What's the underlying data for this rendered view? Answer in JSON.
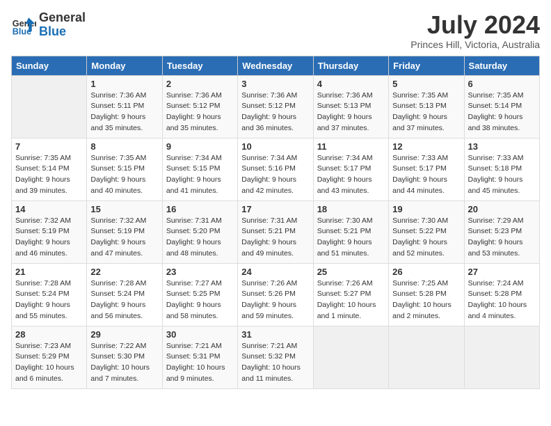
{
  "header": {
    "logo_line1": "General",
    "logo_line2": "Blue",
    "month_title": "July 2024",
    "location": "Princes Hill, Victoria, Australia"
  },
  "days_of_week": [
    "Sunday",
    "Monday",
    "Tuesday",
    "Wednesday",
    "Thursday",
    "Friday",
    "Saturday"
  ],
  "weeks": [
    [
      {
        "day": "",
        "sunrise": "",
        "sunset": "",
        "daylight": ""
      },
      {
        "day": "1",
        "sunrise": "7:36 AM",
        "sunset": "5:11 PM",
        "daylight": "9 hours and 35 minutes."
      },
      {
        "day": "2",
        "sunrise": "7:36 AM",
        "sunset": "5:12 PM",
        "daylight": "9 hours and 35 minutes."
      },
      {
        "day": "3",
        "sunrise": "7:36 AM",
        "sunset": "5:12 PM",
        "daylight": "9 hours and 36 minutes."
      },
      {
        "day": "4",
        "sunrise": "7:36 AM",
        "sunset": "5:13 PM",
        "daylight": "9 hours and 37 minutes."
      },
      {
        "day": "5",
        "sunrise": "7:35 AM",
        "sunset": "5:13 PM",
        "daylight": "9 hours and 37 minutes."
      },
      {
        "day": "6",
        "sunrise": "7:35 AM",
        "sunset": "5:14 PM",
        "daylight": "9 hours and 38 minutes."
      }
    ],
    [
      {
        "day": "7",
        "sunrise": "7:35 AM",
        "sunset": "5:14 PM",
        "daylight": "9 hours and 39 minutes."
      },
      {
        "day": "8",
        "sunrise": "7:35 AM",
        "sunset": "5:15 PM",
        "daylight": "9 hours and 40 minutes."
      },
      {
        "day": "9",
        "sunrise": "7:34 AM",
        "sunset": "5:15 PM",
        "daylight": "9 hours and 41 minutes."
      },
      {
        "day": "10",
        "sunrise": "7:34 AM",
        "sunset": "5:16 PM",
        "daylight": "9 hours and 42 minutes."
      },
      {
        "day": "11",
        "sunrise": "7:34 AM",
        "sunset": "5:17 PM",
        "daylight": "9 hours and 43 minutes."
      },
      {
        "day": "12",
        "sunrise": "7:33 AM",
        "sunset": "5:17 PM",
        "daylight": "9 hours and 44 minutes."
      },
      {
        "day": "13",
        "sunrise": "7:33 AM",
        "sunset": "5:18 PM",
        "daylight": "9 hours and 45 minutes."
      }
    ],
    [
      {
        "day": "14",
        "sunrise": "7:32 AM",
        "sunset": "5:19 PM",
        "daylight": "9 hours and 46 minutes."
      },
      {
        "day": "15",
        "sunrise": "7:32 AM",
        "sunset": "5:19 PM",
        "daylight": "9 hours and 47 minutes."
      },
      {
        "day": "16",
        "sunrise": "7:31 AM",
        "sunset": "5:20 PM",
        "daylight": "9 hours and 48 minutes."
      },
      {
        "day": "17",
        "sunrise": "7:31 AM",
        "sunset": "5:21 PM",
        "daylight": "9 hours and 49 minutes."
      },
      {
        "day": "18",
        "sunrise": "7:30 AM",
        "sunset": "5:21 PM",
        "daylight": "9 hours and 51 minutes."
      },
      {
        "day": "19",
        "sunrise": "7:30 AM",
        "sunset": "5:22 PM",
        "daylight": "9 hours and 52 minutes."
      },
      {
        "day": "20",
        "sunrise": "7:29 AM",
        "sunset": "5:23 PM",
        "daylight": "9 hours and 53 minutes."
      }
    ],
    [
      {
        "day": "21",
        "sunrise": "7:28 AM",
        "sunset": "5:24 PM",
        "daylight": "9 hours and 55 minutes."
      },
      {
        "day": "22",
        "sunrise": "7:28 AM",
        "sunset": "5:24 PM",
        "daylight": "9 hours and 56 minutes."
      },
      {
        "day": "23",
        "sunrise": "7:27 AM",
        "sunset": "5:25 PM",
        "daylight": "9 hours and 58 minutes."
      },
      {
        "day": "24",
        "sunrise": "7:26 AM",
        "sunset": "5:26 PM",
        "daylight": "9 hours and 59 minutes."
      },
      {
        "day": "25",
        "sunrise": "7:26 AM",
        "sunset": "5:27 PM",
        "daylight": "10 hours and 1 minute."
      },
      {
        "day": "26",
        "sunrise": "7:25 AM",
        "sunset": "5:28 PM",
        "daylight": "10 hours and 2 minutes."
      },
      {
        "day": "27",
        "sunrise": "7:24 AM",
        "sunset": "5:28 PM",
        "daylight": "10 hours and 4 minutes."
      }
    ],
    [
      {
        "day": "28",
        "sunrise": "7:23 AM",
        "sunset": "5:29 PM",
        "daylight": "10 hours and 6 minutes."
      },
      {
        "day": "29",
        "sunrise": "7:22 AM",
        "sunset": "5:30 PM",
        "daylight": "10 hours and 7 minutes."
      },
      {
        "day": "30",
        "sunrise": "7:21 AM",
        "sunset": "5:31 PM",
        "daylight": "10 hours and 9 minutes."
      },
      {
        "day": "31",
        "sunrise": "7:21 AM",
        "sunset": "5:32 PM",
        "daylight": "10 hours and 11 minutes."
      },
      {
        "day": "",
        "sunrise": "",
        "sunset": "",
        "daylight": ""
      },
      {
        "day": "",
        "sunrise": "",
        "sunset": "",
        "daylight": ""
      },
      {
        "day": "",
        "sunrise": "",
        "sunset": "",
        "daylight": ""
      }
    ]
  ]
}
